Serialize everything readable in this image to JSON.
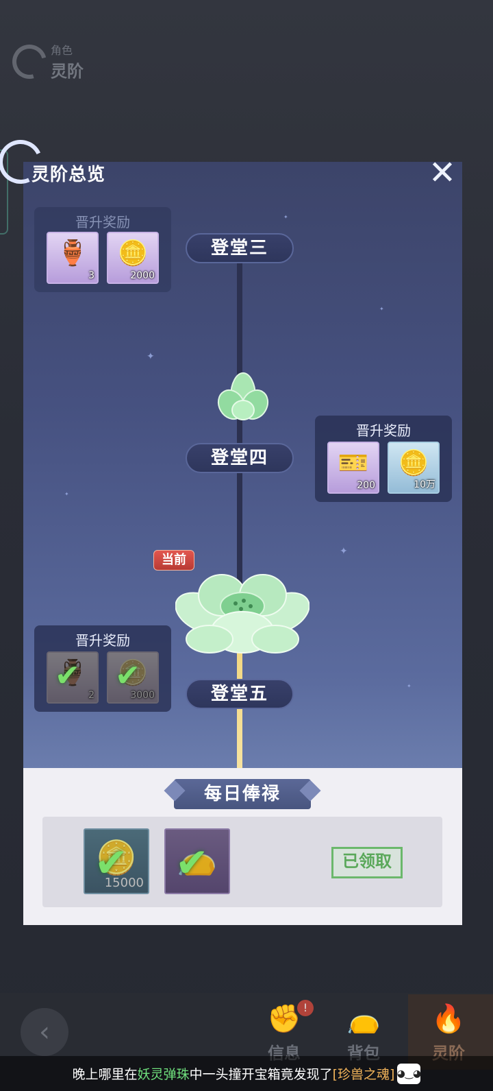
{
  "background_page": {
    "header_small": "角色",
    "header_big": "灵阶",
    "nav": {
      "info_label": "信息",
      "bag_label": "背包",
      "tier_label": "灵阶"
    }
  },
  "ticker": {
    "part1": "晚上哪里在",
    "game_name": "妖灵弹珠",
    "part2": "中一头撞开宝箱竟发现了",
    "item_name": "[珍兽之魂]"
  },
  "panel": {
    "title": "灵阶总览",
    "close_icon": "close-icon",
    "stages": [
      {
        "name": "登堂三",
        "reward_title": "晋升奖励",
        "rewards": [
          {
            "icon": "gourd-icon",
            "glyph": "🏺",
            "qty": "3",
            "claimed": false
          },
          {
            "icon": "gold-ingot-icon",
            "glyph": "🪙",
            "qty": "2000",
            "claimed": false
          }
        ]
      },
      {
        "name": "登堂四",
        "reward_title": "晋升奖励",
        "rewards": [
          {
            "icon": "talisman-icon",
            "glyph": "🎫",
            "qty": "200",
            "claimed": false
          },
          {
            "icon": "copper-coin-icon",
            "glyph": "🪙",
            "qty": "10万",
            "claimed": false
          }
        ]
      },
      {
        "name": "登堂五",
        "current_tag": "当前",
        "reward_title": "晋升奖励",
        "rewards": [
          {
            "icon": "gourd-icon",
            "glyph": "🏺",
            "qty": "2",
            "claimed": true
          },
          {
            "icon": "gold-ingot-icon",
            "glyph": "🪙",
            "qty": "3000",
            "claimed": true
          }
        ]
      }
    ],
    "daily": {
      "title": "每日俸禄",
      "rewards": [
        {
          "icon": "copper-coin-icon",
          "glyph": "🪙",
          "qty": "15000"
        },
        {
          "icon": "pouch-icon",
          "glyph": "👝",
          "qty": ""
        }
      ],
      "status": "已领取"
    }
  }
}
